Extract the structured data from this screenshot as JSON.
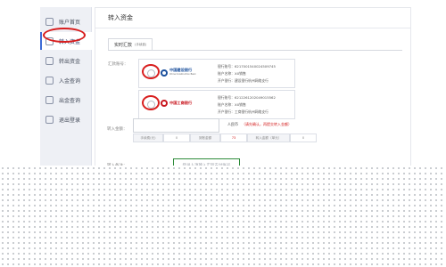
{
  "sidebar": {
    "items": [
      {
        "label": "账户首页",
        "icon": "home-icon"
      },
      {
        "label": "转入资金",
        "icon": "transfer-in-icon",
        "active": true
      },
      {
        "label": "转出资金",
        "icon": "transfer-out-icon"
      },
      {
        "label": "入金查询",
        "icon": "deposit-query-icon"
      },
      {
        "label": "出金查询",
        "icon": "withdraw-query-icon"
      },
      {
        "label": "退出登录",
        "icon": "logout-icon"
      }
    ]
  },
  "main": {
    "title": "转入资金",
    "tab": {
      "label": "实时汇款",
      "sub": "(手续费)"
    },
    "bank_label": "汇款账号：",
    "banks": [
      {
        "name": "中国建设银行",
        "sub": "China Construction Bank",
        "brand_color": "#1a4f9c",
        "lines": [
          "银行账号：6217001540024509745",
          "账户名称：XX销售",
          "开户银行：建设银行杭州网络支行"
        ]
      },
      {
        "name": "中国工商银行",
        "sub": "",
        "brand_color": "#c8151d",
        "lines": [
          "银行账号：6212261202049015562",
          "账户名称：XX销售",
          "开户银行：工商银行杭州网络支行"
        ]
      }
    ],
    "amount_label": "转入金额：",
    "amount_hint": "人民币",
    "amount_warning": "（请先确认，再提交转入金额）",
    "fees": [
      {
        "key": "手续费(元)",
        "val": "0"
      },
      {
        "key": "到账金额",
        "val": "73"
      },
      {
        "key": "转入金额（单元）",
        "val": "0"
      }
    ],
    "pwd_label": "转入备注：",
    "pwd_placeholder": "登录人须输入实际支付账号"
  },
  "annotation_color": "#d81e1e",
  "highlight_color": "#2e8b3a"
}
